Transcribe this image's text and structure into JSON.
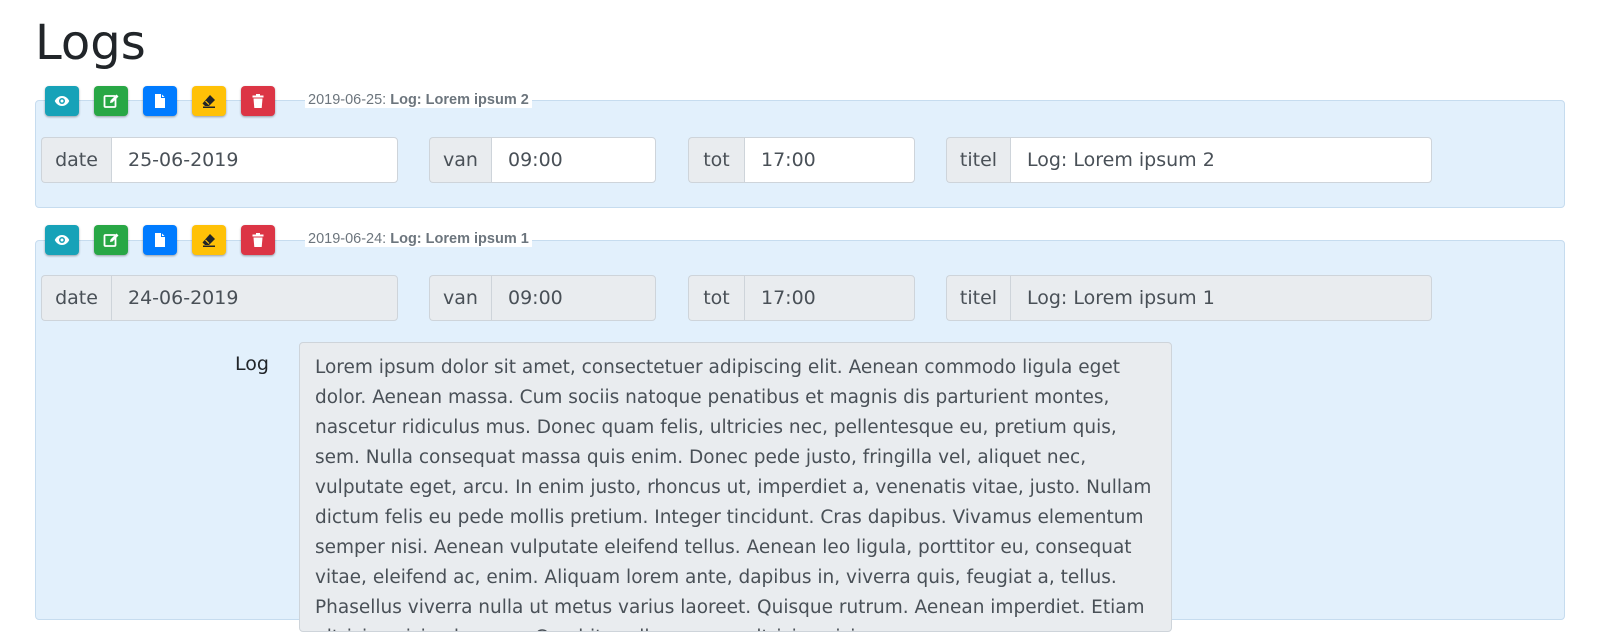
{
  "page": {
    "title": "Logs"
  },
  "actions": [
    {
      "icon": "eye-icon",
      "color": "#17a2b8"
    },
    {
      "icon": "edit-icon",
      "color": "#28a745"
    },
    {
      "icon": "file-icon",
      "color": "#007bff"
    },
    {
      "icon": "eraser-icon",
      "color": "#ffc107"
    },
    {
      "icon": "trash-icon",
      "color": "#dc3545"
    }
  ],
  "logs": [
    {
      "legend_date": "2019-06-25:",
      "legend_title": "Log: Lorem ipsum 2",
      "date_label": "date",
      "date_value": "25-06-2019",
      "from_label": "van",
      "from_value": "09:00",
      "to_label": "tot",
      "to_value": "17:00",
      "title_label": "titel",
      "title_value": "Log: Lorem ipsum 2"
    },
    {
      "legend_date": "2019-06-24:",
      "legend_title": "Log: Lorem ipsum 1",
      "date_label": "date",
      "date_value": "24-06-2019",
      "from_label": "van",
      "from_value": "09:00",
      "to_label": "tot",
      "to_value": "17:00",
      "title_label": "titel",
      "title_value": "Log: Lorem ipsum 1",
      "log_label": "Log",
      "log_text": "Lorem ipsum dolor sit amet, consectetuer adipiscing elit. Aenean commodo ligula eget dolor. Aenean massa. Cum sociis natoque penatibus et magnis dis parturient montes, nascetur ridiculus mus. Donec quam felis, ultricies nec, pellentesque eu, pretium quis, sem. Nulla consequat massa quis enim. Donec pede justo, fringilla vel, aliquet nec, vulputate eget, arcu. In enim justo, rhoncus ut, imperdiet a, venenatis vitae, justo. Nullam dictum felis eu pede mollis pretium. Integer tincidunt. Cras dapibus. Vivamus elementum semper nisi. Aenean vulputate eleifend tellus. Aenean leo ligula, porttitor eu, consequat vitae, eleifend ac, enim. Aliquam lorem ante, dapibus in, viverra quis, feugiat a, tellus. Phasellus viverra nulla ut metus varius laoreet. Quisque rutrum. Aenean imperdiet. Etiam ultricies nisi vel augue. Curabitur ullamcorper ultricies nisi."
    }
  ]
}
